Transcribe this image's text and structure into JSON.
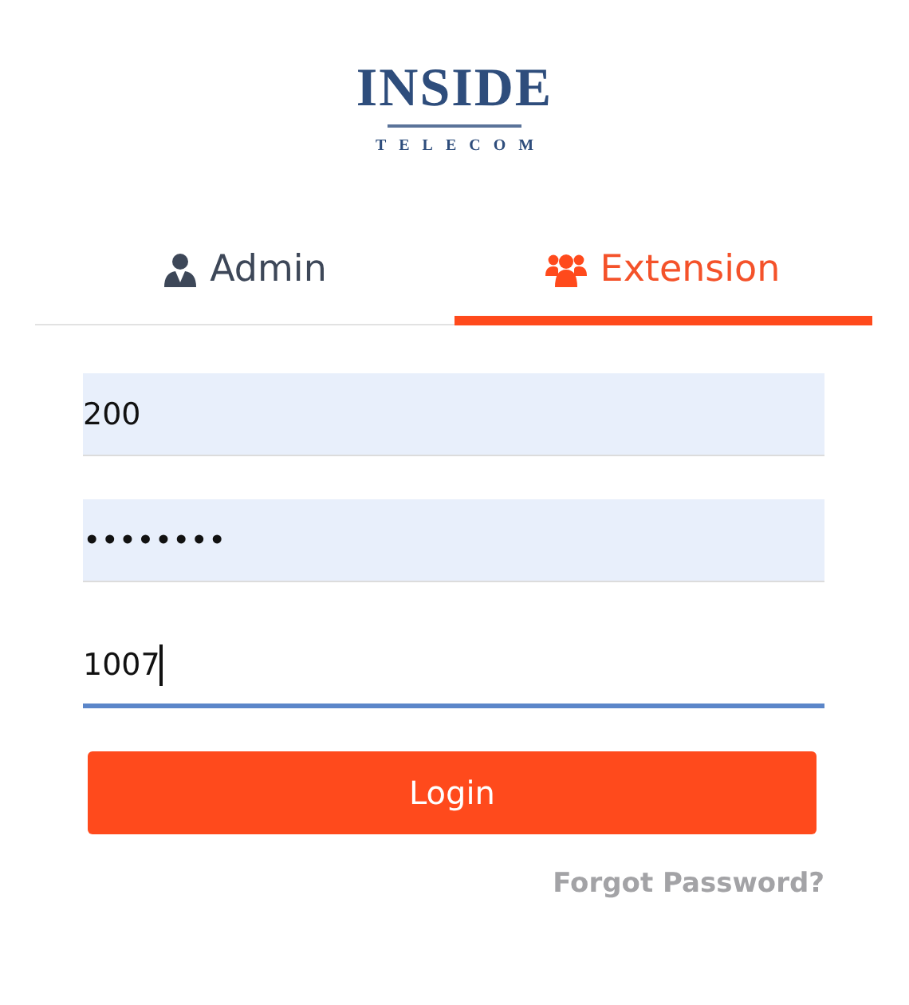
{
  "logo": {
    "name": "INSIDE",
    "tagline": "TELECOM"
  },
  "tabs": [
    {
      "label": "Admin",
      "kind": "admin",
      "selected": false
    },
    {
      "label": "Extension",
      "kind": "group",
      "selected": true
    }
  ],
  "fields": [
    {
      "value": "200",
      "focused": false
    },
    {
      "value": "••••••••",
      "focused": false
    },
    {
      "value": "1007",
      "focused": true
    }
  ],
  "login_button": "Login",
  "forgot_link": "Forgot Password?"
}
